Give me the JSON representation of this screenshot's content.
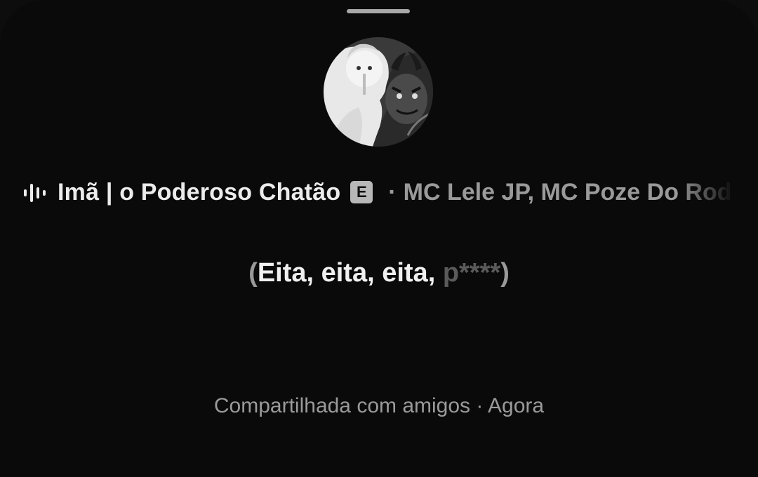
{
  "track": {
    "title": "Imã | o Poderoso Chatão",
    "explicit_badge": "E",
    "separator": "·",
    "artists": "MC Lele JP, MC Poze Do Rodo"
  },
  "lyric": {
    "open_paren": "(",
    "bright_text": "Eita, eita, eita, ",
    "dim_text": "p****",
    "close_paren": ")"
  },
  "footer": {
    "text": "Compartilhada com amigos · Agora"
  },
  "icons": {
    "now_playing": "audio-bars-icon",
    "explicit": "explicit-badge-icon"
  },
  "colors": {
    "background": "#0a0a0a",
    "primary_text": "#ececec",
    "secondary_text": "#9a9a9a",
    "badge_bg": "#b7b7b7"
  }
}
